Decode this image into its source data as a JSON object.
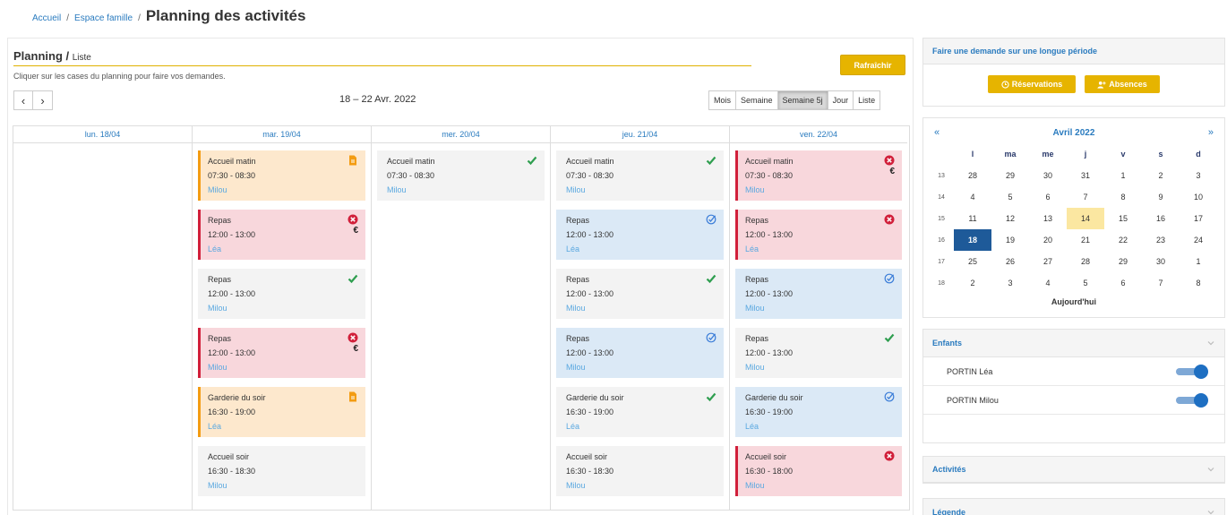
{
  "breadcrumb": {
    "home": "Accueil",
    "sep": "/",
    "family": "Espace famille",
    "title": "Planning des activités"
  },
  "planning": {
    "heading": "Planning /",
    "heading_sub": "Liste",
    "help": "Cliquer sur les cases du planning pour faire vos demandes.",
    "refresh_label": "Rafraîchir",
    "prev": "‹",
    "next": "›",
    "date_range": "18 – 22 Avr. 2022",
    "views": [
      "Mois",
      "Semaine",
      "Semaine 5j",
      "Jour",
      "Liste"
    ],
    "active_view": "Semaine 5j"
  },
  "days": [
    {
      "label": "lun. 18/04",
      "events": []
    },
    {
      "label": "mar. 19/04",
      "events": [
        {
          "title": "Accueil matin",
          "time": "07:30 - 08:30",
          "child": "Milou",
          "state": "pending",
          "euro": false
        },
        {
          "title": "Repas",
          "time": "12:00 - 13:00",
          "child": "Léa",
          "state": "refused",
          "euro": true
        },
        {
          "title": "Repas",
          "time": "12:00 - 13:00",
          "child": "Milou",
          "state": "ok",
          "euro": false
        },
        {
          "title": "Repas",
          "time": "12:00 - 13:00",
          "child": "Milou",
          "state": "refused",
          "euro": true
        },
        {
          "title": "Garderie du soir",
          "time": "16:30 - 19:00",
          "child": "Léa",
          "state": "pending",
          "euro": false
        },
        {
          "title": "Accueil soir",
          "time": "16:30 - 18:30",
          "child": "Milou",
          "state": "none",
          "euro": false
        }
      ]
    },
    {
      "label": "mer. 20/04",
      "events": [
        {
          "title": "Accueil matin",
          "time": "07:30 - 08:30",
          "child": "Milou",
          "state": "ok",
          "euro": false
        }
      ]
    },
    {
      "label": "jeu. 21/04",
      "events": [
        {
          "title": "Accueil matin",
          "time": "07:30 - 08:30",
          "child": "Milou",
          "state": "ok",
          "euro": false
        },
        {
          "title": "Repas",
          "time": "12:00 - 13:00",
          "child": "Léa",
          "state": "request",
          "euro": false
        },
        {
          "title": "Repas",
          "time": "12:00 - 13:00",
          "child": "Milou",
          "state": "ok",
          "euro": false
        },
        {
          "title": "Repas",
          "time": "12:00 - 13:00",
          "child": "Milou",
          "state": "request",
          "euro": false
        },
        {
          "title": "Garderie du soir",
          "time": "16:30 - 19:00",
          "child": "Léa",
          "state": "ok",
          "euro": false
        },
        {
          "title": "Accueil soir",
          "time": "16:30 - 18:30",
          "child": "Milou",
          "state": "none",
          "euro": false
        }
      ]
    },
    {
      "label": "ven. 22/04",
      "events": [
        {
          "title": "Accueil matin",
          "time": "07:30 - 08:30",
          "child": "Milou",
          "state": "refused",
          "euro": true
        },
        {
          "title": "Repas",
          "time": "12:00 - 13:00",
          "child": "Léa",
          "state": "refused",
          "euro": false
        },
        {
          "title": "Repas",
          "time": "12:00 - 13:00",
          "child": "Milou",
          "state": "request",
          "euro": false
        },
        {
          "title": "Repas",
          "time": "12:00 - 13:00",
          "child": "Milou",
          "state": "ok",
          "euro": false
        },
        {
          "title": "Garderie du soir",
          "time": "16:30 - 19:00",
          "child": "Léa",
          "state": "request",
          "euro": false
        },
        {
          "title": "Accueil soir",
          "time": "16:30 - 18:00",
          "child": "Milou",
          "state": "refused",
          "euro": false
        }
      ]
    }
  ],
  "euro_symbol": "€",
  "long_request": {
    "title": "Faire une demande sur une longue période",
    "reservations_label": "Réservations",
    "absences_label": "Absences"
  },
  "mini_calendar": {
    "prev": "«",
    "next": "»",
    "title": "Avril 2022",
    "weekdays": [
      "l",
      "ma",
      "me",
      "j",
      "v",
      "s",
      "d"
    ],
    "weeks": [
      {
        "num": "13",
        "days": [
          "28",
          "29",
          "30",
          "31",
          "1",
          "2",
          "3"
        ]
      },
      {
        "num": "14",
        "days": [
          "4",
          "5",
          "6",
          "7",
          "8",
          "9",
          "10"
        ]
      },
      {
        "num": "15",
        "days": [
          "11",
          "12",
          "13",
          "14",
          "15",
          "16",
          "17"
        ]
      },
      {
        "num": "16",
        "days": [
          "18",
          "19",
          "20",
          "21",
          "22",
          "23",
          "24"
        ]
      },
      {
        "num": "17",
        "days": [
          "25",
          "26",
          "27",
          "28",
          "29",
          "30",
          "1"
        ]
      },
      {
        "num": "18",
        "days": [
          "2",
          "3",
          "4",
          "5",
          "6",
          "7",
          "8"
        ]
      }
    ],
    "today": "14",
    "selected": "18",
    "today_label": "Aujourd'hui"
  },
  "children_panel": {
    "title": "Enfants",
    "children": [
      {
        "name": "PORTIN Léa",
        "enabled": true
      },
      {
        "name": "PORTIN Milou",
        "enabled": true
      }
    ]
  },
  "activities_panel": {
    "title": "Activités"
  },
  "legend_panel": {
    "title": "Légende"
  },
  "colors": {
    "accent": "#e6b400",
    "link": "#2a7bbf",
    "pending": "#f39c12",
    "refused": "#d11f3a",
    "ok": "#2e9e4f",
    "request": "#3b7dd8"
  }
}
